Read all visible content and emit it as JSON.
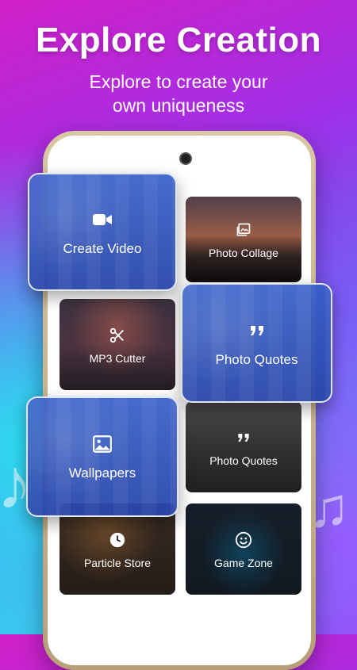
{
  "header": {
    "title": "Explore Creation",
    "subtitle_line1": "Explore to create your",
    "subtitle_line2": "own uniqueness"
  },
  "tiles": {
    "create_video": {
      "label": "Create Video",
      "icon": "video-camera-icon"
    },
    "photo_collage": {
      "label": "Photo Collage",
      "icon": "collage-icon"
    },
    "mp3_cutter": {
      "label": "MP3 Cutter",
      "icon": "scissors-icon"
    },
    "photo_quotes_big": {
      "label": "Photo Quotes",
      "icon": "quote-icon"
    },
    "wallpapers": {
      "label": "Wallpapers",
      "icon": "image-icon"
    },
    "photo_quotes_small": {
      "label": "Photo Quotes",
      "icon": "quote-icon"
    },
    "particle_store": {
      "label": "Particle Store",
      "icon": "clock-icon"
    },
    "game_zone": {
      "label": "Game Zone",
      "icon": "smiley-icon"
    }
  },
  "colors": {
    "glass_tile": "#3a62c8",
    "accent_magenta": "#d020c8",
    "accent_cyan": "#37c8ee"
  }
}
